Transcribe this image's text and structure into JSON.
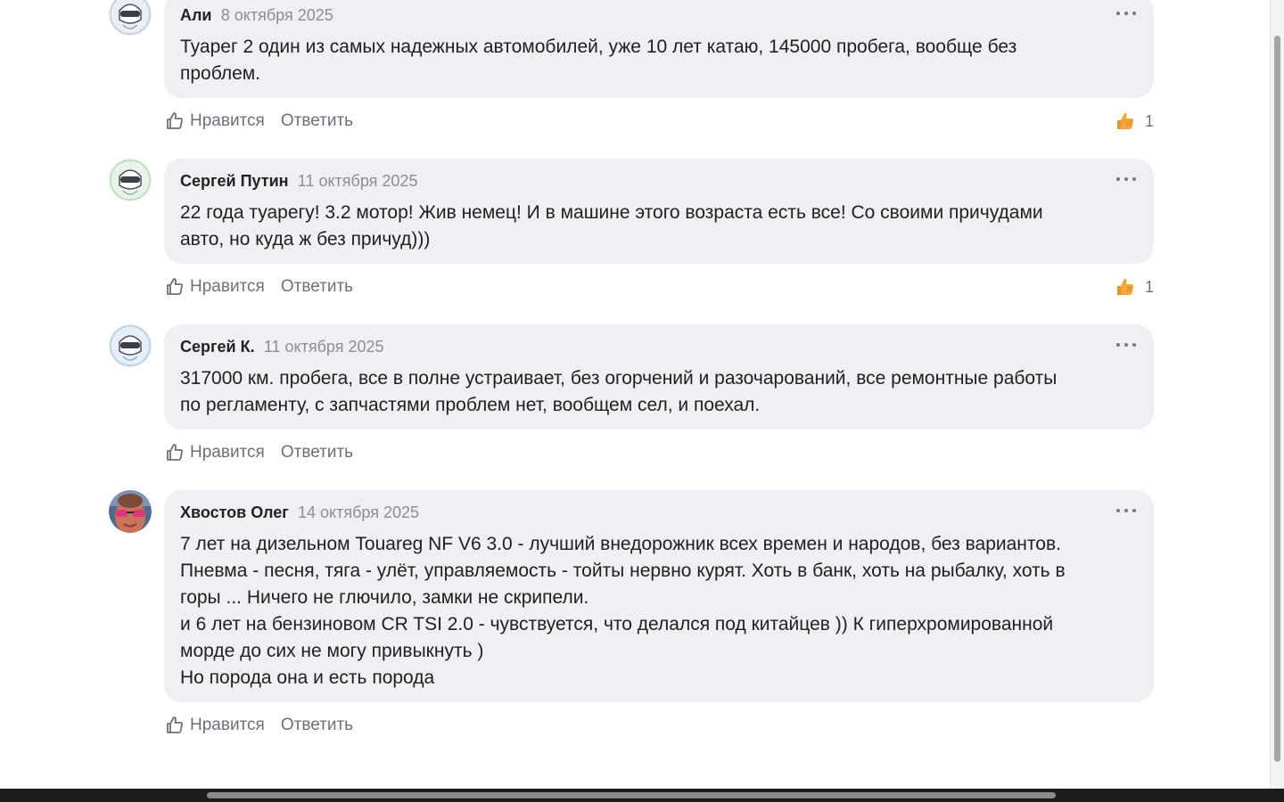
{
  "actions": {
    "like_label": "Нравится",
    "reply_label": "Ответить"
  },
  "comments": [
    {
      "author": "Али",
      "date": "8 октября 2025",
      "text": "Туарег 2 один из самых надежных автомобилей, уже 10 лет катаю, 145000 пробега, вообще без\nпроблем.",
      "avatar": "robot-avatar",
      "likes": "1"
    },
    {
      "author": "Сергей Путин",
      "date": "11 октября 2025",
      "text": "22 года туарегу! 3.2 мотор! Жив немец! И в машине этого возраста есть все! Со своими причудами\nавто, но куда ж без причуд)))",
      "avatar": "robot-avatar",
      "likes": "1"
    },
    {
      "author": "Сергей К.",
      "date": "11 октября 2025",
      "text": "317000 км. пробега, все в полне устраивает, без огорчений и разочарований, все ремонтные работы\nпо регламенту, с запчастями проблем нет, вообщем сел, и поехал.",
      "avatar": "robot-avatar",
      "likes": ""
    },
    {
      "author": "Хвостов Олег",
      "date": "14 октября 2025",
      "text": "7 лет на дизельном Touareg NF V6 3.0 - лучший внедорожник всех времен и народов, без вариантов.\nПневма - песня, тяга - улёт, управляемость - тойты нервно курят. Хоть в банк, хоть на рыбалку, хоть в\nгоры ... Ничего не глючило, замки не скрипели.\nи 6 лет на бензиновом CR TSI 2.0 - чувствуется, что делался под китайцев )) К гиперхромированной\nморде до сих не могу привыкнуть )\nНо порода она и есть порода",
      "avatar": "photo-avatar",
      "likes": ""
    }
  ],
  "colors": {
    "bubble_bg": "#eff0f4",
    "muted_text": "#8b8e96",
    "reaction_thumb": "#f4a63a"
  }
}
